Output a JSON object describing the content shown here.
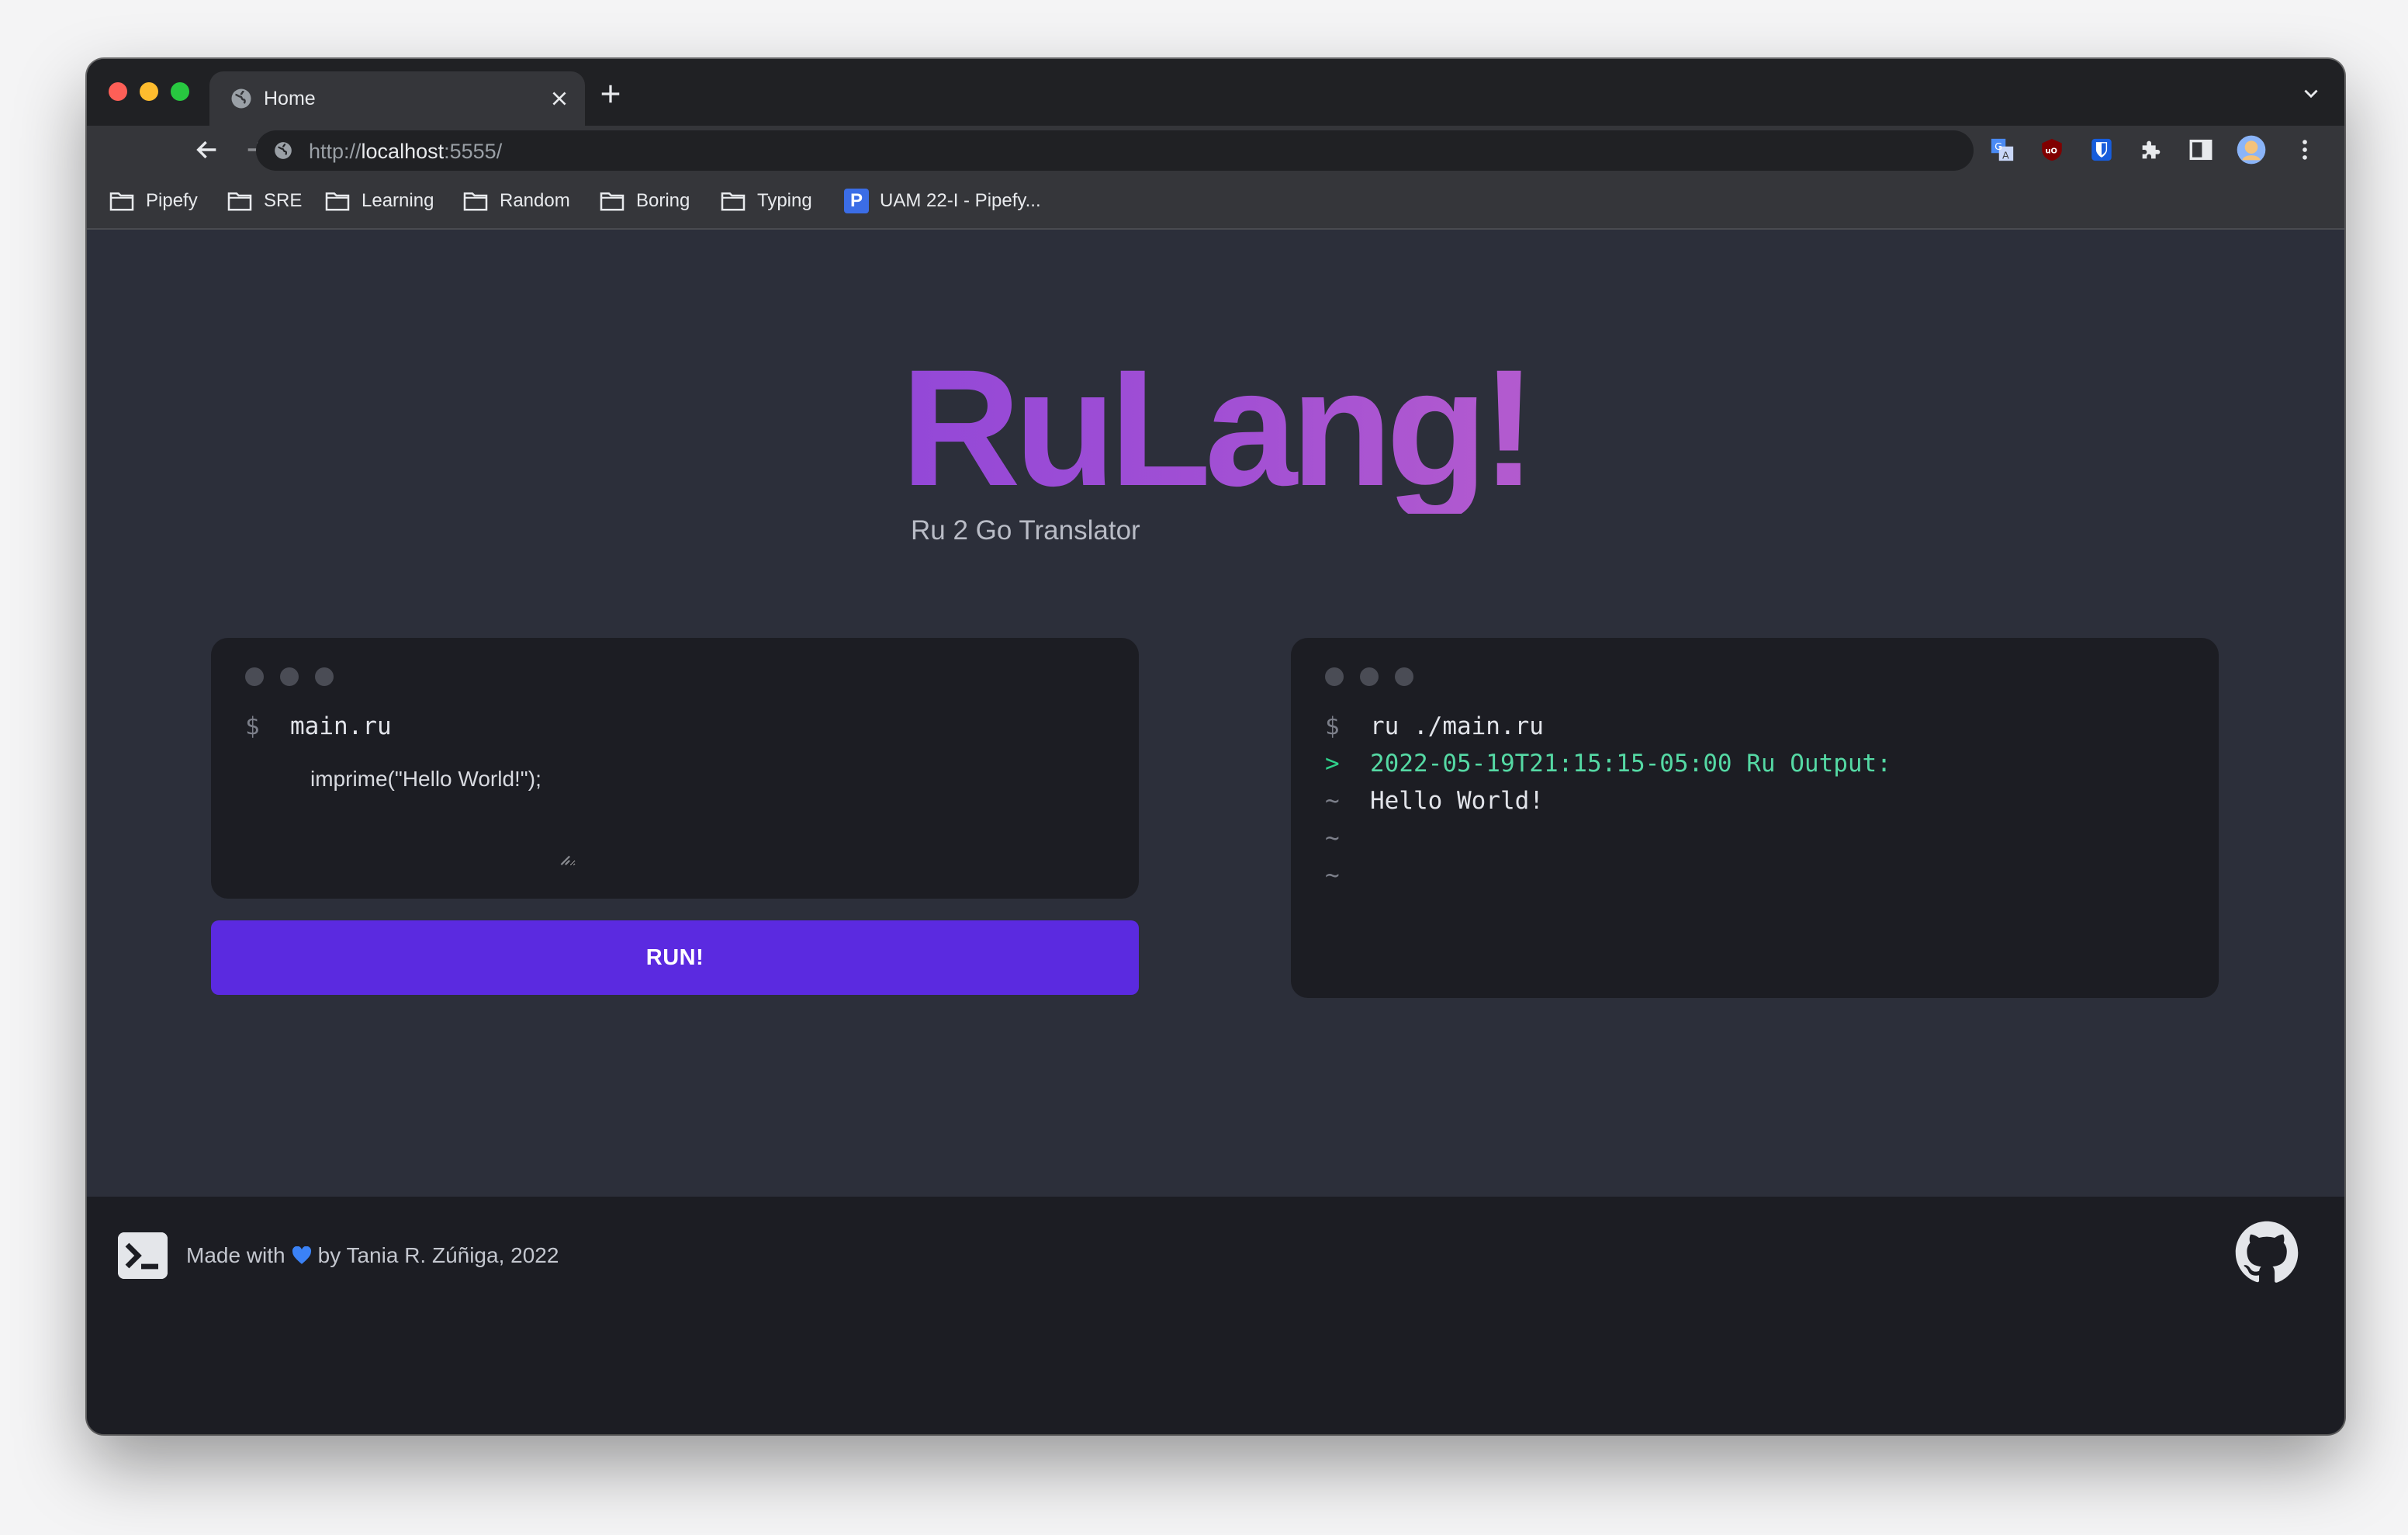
{
  "browser": {
    "tab": {
      "title": "Home",
      "favicon": "globe-icon",
      "close": "close-icon"
    },
    "new_tab": "plus-icon",
    "address": {
      "scheme": "http://",
      "host": "localhost",
      "rest": ":5555/"
    },
    "extensions": [
      "translate-icon",
      "ublock-icon",
      "bitwarden-icon",
      "puzzle-icon",
      "sidebar-icon",
      "profile-avatar",
      "kebab-menu-icon"
    ],
    "bookmarks": [
      {
        "label": "Pipefy",
        "icon": "folder-icon"
      },
      {
        "label": "SRE",
        "icon": "folder-icon"
      },
      {
        "label": "Learning",
        "icon": "folder-icon"
      },
      {
        "label": "Random",
        "icon": "folder-icon"
      },
      {
        "label": "Boring",
        "icon": "folder-icon"
      },
      {
        "label": "Typing",
        "icon": "folder-icon"
      },
      {
        "label": "UAM 22-I - Pipefy...",
        "icon": "pipefy-icon",
        "icon_letter": "P"
      }
    ]
  },
  "hero": {
    "title": "RuLang!",
    "subtitle": "Ru 2 Go Translator",
    "gradient": [
      "#7036e0",
      "#a14fd4",
      "#e27ac0"
    ]
  },
  "editor": {
    "prompt": "$",
    "filename": "main.ru",
    "code": "imprime(\"Hello World!\");"
  },
  "run_button": {
    "label": "RUN!",
    "color": "#5b2ae0"
  },
  "output": {
    "lines": [
      {
        "prompt": "$",
        "text": "ru ./main.ru"
      },
      {
        "prompt": ">",
        "text": "2022-05-19T21:15:15-05:00 Ru Output:"
      },
      {
        "prompt": "~",
        "text": "Hello World!"
      },
      {
        "prompt": "~",
        "text": ""
      },
      {
        "prompt": "~",
        "text": ""
      }
    ]
  },
  "footer": {
    "prefix": "Made with",
    "suffix": "by Tania R. Zúñiga, 2022",
    "heart_icon": "blue-heart-icon",
    "logo_icon": "terminal-icon",
    "github_icon": "github-icon"
  }
}
